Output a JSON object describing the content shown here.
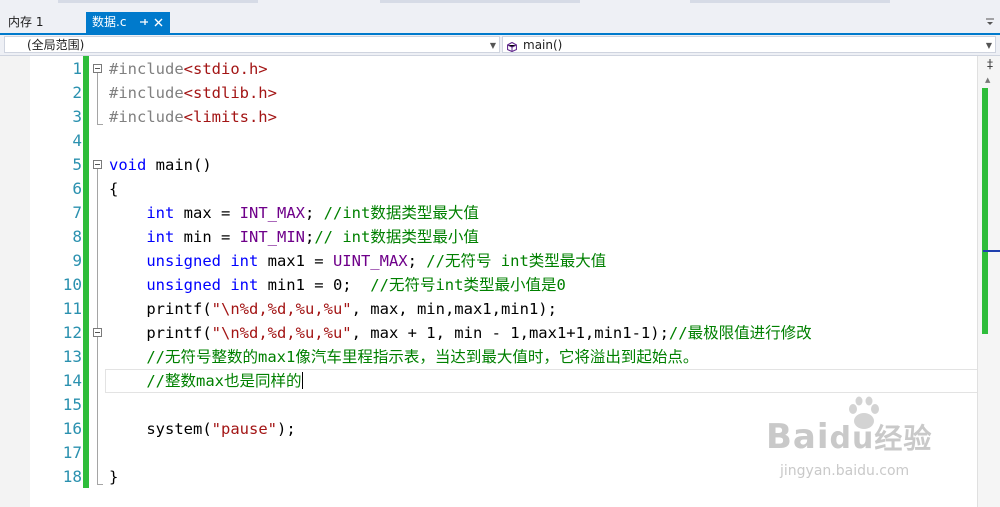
{
  "tabs": {
    "inactive_label": "内存 1",
    "active_label": "数据.c",
    "pin_glyph": "⊕",
    "close_glyph": "✕"
  },
  "navbar": {
    "scope_value": "(全局范围)",
    "function_value": "main()",
    "function_icon": "cube-icon"
  },
  "colors": {
    "accent": "#007acc",
    "change_bar": "#2ebd3a",
    "keyword": "#0000ff",
    "preprocessor": "#808080",
    "string": "#a31515",
    "macro": "#6f008a",
    "comment": "#008000",
    "line_number": "#2b91af"
  },
  "editor": {
    "line_numbers": [
      "1",
      "2",
      "3",
      "4",
      "5",
      "6",
      "7",
      "8",
      "9",
      "10",
      "11",
      "12",
      "13",
      "14",
      "15",
      "16",
      "17",
      "18"
    ],
    "current_line": 14,
    "lines": [
      [
        {
          "t": "pp",
          "v": "#include"
        },
        {
          "t": "inc",
          "v": "<stdio.h>"
        }
      ],
      [
        {
          "t": "pp",
          "v": "#include"
        },
        {
          "t": "inc",
          "v": "<stdlib.h>"
        }
      ],
      [
        {
          "t": "pp",
          "v": "#include"
        },
        {
          "t": "inc",
          "v": "<limits.h>"
        }
      ],
      [],
      [
        {
          "t": "kw",
          "v": "void"
        },
        {
          "t": "tx",
          "v": " main()"
        }
      ],
      [
        {
          "t": "tx",
          "v": "{"
        }
      ],
      [
        {
          "t": "tx",
          "v": "    "
        },
        {
          "t": "kw",
          "v": "int"
        },
        {
          "t": "tx",
          "v": " max = "
        },
        {
          "t": "mac",
          "v": "INT_MAX"
        },
        {
          "t": "tx",
          "v": "; "
        },
        {
          "t": "cm",
          "v": "//int数据类型最大值"
        }
      ],
      [
        {
          "t": "tx",
          "v": "    "
        },
        {
          "t": "kw",
          "v": "int"
        },
        {
          "t": "tx",
          "v": " min = "
        },
        {
          "t": "mac",
          "v": "INT_MIN"
        },
        {
          "t": "tx",
          "v": ";"
        },
        {
          "t": "cm",
          "v": "// int数据类型最小值"
        }
      ],
      [
        {
          "t": "tx",
          "v": "    "
        },
        {
          "t": "kw",
          "v": "unsigned int"
        },
        {
          "t": "tx",
          "v": " max1 = "
        },
        {
          "t": "mac",
          "v": "UINT_MAX"
        },
        {
          "t": "tx",
          "v": "; "
        },
        {
          "t": "cm",
          "v": "//无符号 int类型最大值"
        }
      ],
      [
        {
          "t": "tx",
          "v": "    "
        },
        {
          "t": "kw",
          "v": "unsigned int"
        },
        {
          "t": "tx",
          "v": " min1 = 0;  "
        },
        {
          "t": "cm",
          "v": "//无符号int类型最小值是0"
        }
      ],
      [
        {
          "t": "tx",
          "v": "    printf("
        },
        {
          "t": "str",
          "v": "\"\\n%d,%d,%u,%u\""
        },
        {
          "t": "tx",
          "v": ", max, min,max1,min1);"
        }
      ],
      [
        {
          "t": "tx",
          "v": "    printf("
        },
        {
          "t": "str",
          "v": "\"\\n%d,%d,%u,%u\""
        },
        {
          "t": "tx",
          "v": ", max + 1, min - 1,max1+1,min1-1);"
        },
        {
          "t": "cm",
          "v": "//最极限值进行修改"
        }
      ],
      [
        {
          "t": "tx",
          "v": "    "
        },
        {
          "t": "cm",
          "v": "//无符号整数的max1像汽车里程指示表，当达到最大值时，它将溢出到起始点。"
        }
      ],
      [
        {
          "t": "tx",
          "v": "    "
        },
        {
          "t": "cm",
          "v": "//整数max也是同样的"
        }
      ],
      [],
      [
        {
          "t": "tx",
          "v": "    system("
        },
        {
          "t": "str",
          "v": "\"pause\""
        },
        {
          "t": "tx",
          "v": ");"
        }
      ],
      [],
      [
        {
          "t": "tx",
          "v": "}"
        }
      ]
    ]
  },
  "scrollbar": {
    "split_glyph": "‡",
    "up_glyph": "▲"
  },
  "watermark": {
    "brand": "Bai",
    "brand_suffix": "经验",
    "url": "jingyan.baidu.com"
  }
}
